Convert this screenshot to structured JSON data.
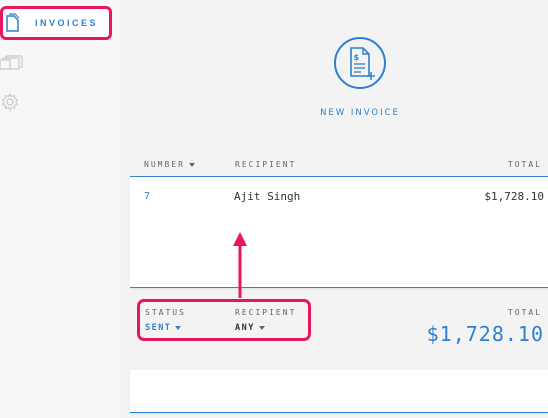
{
  "sidebar": {
    "items": [
      {
        "label": "INVOICES",
        "icon": "document-icon",
        "active": true
      },
      {
        "label": "",
        "icon": "cards-icon"
      },
      {
        "label": "",
        "icon": "gear-icon"
      }
    ]
  },
  "new_invoice": {
    "label": "NEW INVOICE",
    "icon": "new-invoice-icon"
  },
  "table": {
    "headers": {
      "number": "NUMBER",
      "recipient": "RECIPIENT",
      "total": "TOTAL"
    },
    "rows": [
      {
        "number": "7",
        "recipient": "Ajit Singh",
        "total": "$1,728.10"
      }
    ]
  },
  "summary": {
    "status_label": "STATUS",
    "status_value": "SENT",
    "recipient_label": "RECIPIENT",
    "recipient_value": "ANY",
    "total_label": "TOTAL",
    "total_value": "$1,728.10"
  },
  "colors": {
    "accent": "#2f7fd0",
    "highlight": "#e8175d"
  }
}
